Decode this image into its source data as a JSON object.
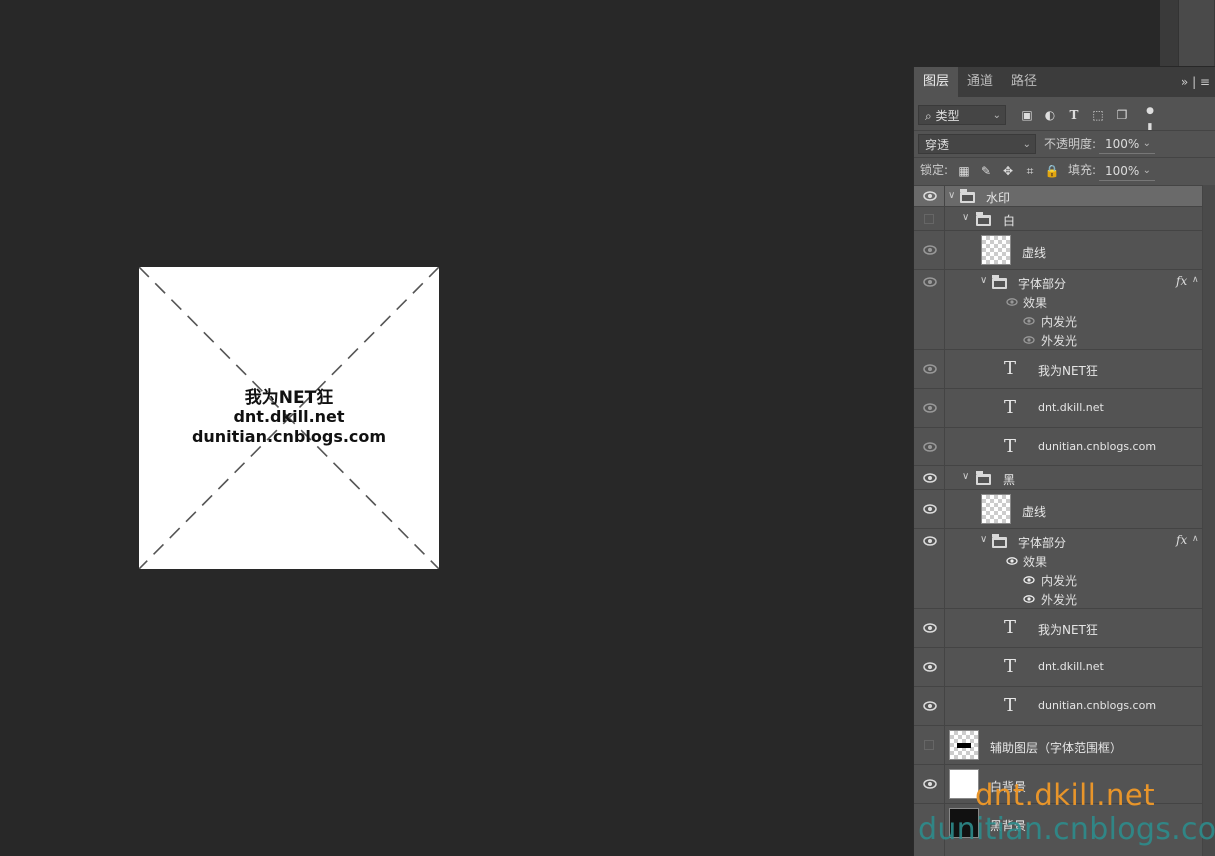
{
  "canvas": {
    "watermark_line1": "我为NET狂",
    "watermark_line2": "dnt.dkill.net",
    "watermark_line3": "dunitian.cnblogs.com"
  },
  "panel": {
    "tabs": [
      "图层",
      "通道",
      "路径"
    ],
    "filter_kind": "类型",
    "blend_mode": "穿透",
    "opacity_label": "不透明度:",
    "opacity_value": "100%",
    "lock_label": "锁定:",
    "fill_label": "填充:",
    "fill_value": "100%"
  },
  "layers": {
    "watermark_group": "水印",
    "white_group": "白",
    "white_dashed": "虚线",
    "white_font_group": "字体部分",
    "white_effects": "效果",
    "white_inner_glow": "内发光",
    "white_outer_glow": "外发光",
    "white_text1": "我为NET狂",
    "white_text2": "dnt.dkill.net",
    "white_text3": "dunitian.cnblogs.com",
    "black_group": "黑",
    "black_dashed": "虚线",
    "black_font_group": "字体部分",
    "black_effects": "效果",
    "black_inner_glow": "内发光",
    "black_outer_glow": "外发光",
    "black_text1": "我为NET狂",
    "black_text2": "dnt.dkill.net",
    "black_text3": "dunitian.cnblogs.com",
    "helper": "辅助图层（字体范围框）",
    "white_bg": "白背景",
    "black_bg": "黑背景",
    "fx": "fx",
    "type_glyph": "T"
  },
  "bottom_watermark": {
    "line1": "dnt.dkill.net",
    "line2": "dunitian.cnblogs.com"
  },
  "colors": {
    "watermark_orange": "#e8952a",
    "watermark_teal": "#2d8c8c"
  }
}
